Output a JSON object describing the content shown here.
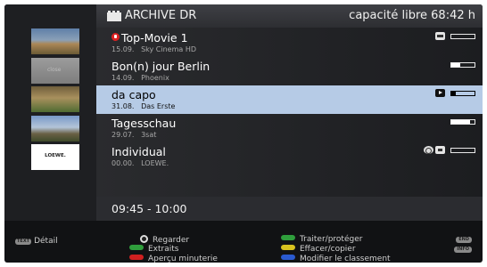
{
  "header": {
    "title": "ARCHIVE DR",
    "free_capacity": "capacité libre 68:42 h",
    "icon": "film-archive-icon"
  },
  "thumbnails": [
    {
      "icon": "landscape-thumbnail"
    },
    {
      "caption": "close"
    },
    {
      "icon": "village-thumbnail"
    },
    {
      "icon": "castle-thumbnail"
    },
    {
      "caption": "LOEWE."
    }
  ],
  "recordings": [
    {
      "title": "Top-Movie 1",
      "date": "15.09.",
      "channel": "Sky Cinema HD",
      "locked": true,
      "status_icons": [
        "key-icon"
      ],
      "progress": 0.0,
      "selected": false
    },
    {
      "title": "Bon(n) jour Berlin",
      "date": "14.09.",
      "channel": "Phoenix",
      "locked": false,
      "status_icons": [],
      "progress": 0.4,
      "selected": false
    },
    {
      "title": "da capo",
      "date": "31.08.",
      "channel": "Das Erste",
      "locked": false,
      "status_icons": [
        "play-icon"
      ],
      "progress": 0.2,
      "selected": true
    },
    {
      "title": "Tagesschau",
      "date": "29.07.",
      "channel": "3sat",
      "locked": false,
      "status_icons": [],
      "progress": 0.8,
      "selected": false
    },
    {
      "title": "Individual",
      "date": "00.00.",
      "channel": "LOEWE.",
      "locked": false,
      "status_icons": [
        "timer-icon",
        "edit-icon"
      ],
      "progress": 0.0,
      "selected": false
    }
  ],
  "time_range": "09:45 - 10:00",
  "footer": {
    "detail": {
      "key": "TEXT",
      "label": "Détail"
    },
    "watch": {
      "key": "OK",
      "label": "Regarder"
    },
    "extracts": {
      "key": "green",
      "label": "Extraits"
    },
    "timer_preview": {
      "key": "red",
      "label": "Aperçu minuterie"
    },
    "edit_protect": {
      "key": "green",
      "label": "Traiter/protéger"
    },
    "delete_copy": {
      "key": "yellow",
      "label": "Effacer/copier"
    },
    "sort": {
      "key": "blue",
      "label": "Modifier le classement"
    },
    "end_key": "END",
    "info_key": "INFO"
  },
  "colors": {
    "selected_row": "#b6cbe6",
    "red": "#d02020",
    "green": "#2f9e3c",
    "yellow": "#d8c21f",
    "blue": "#2a5ad0"
  }
}
